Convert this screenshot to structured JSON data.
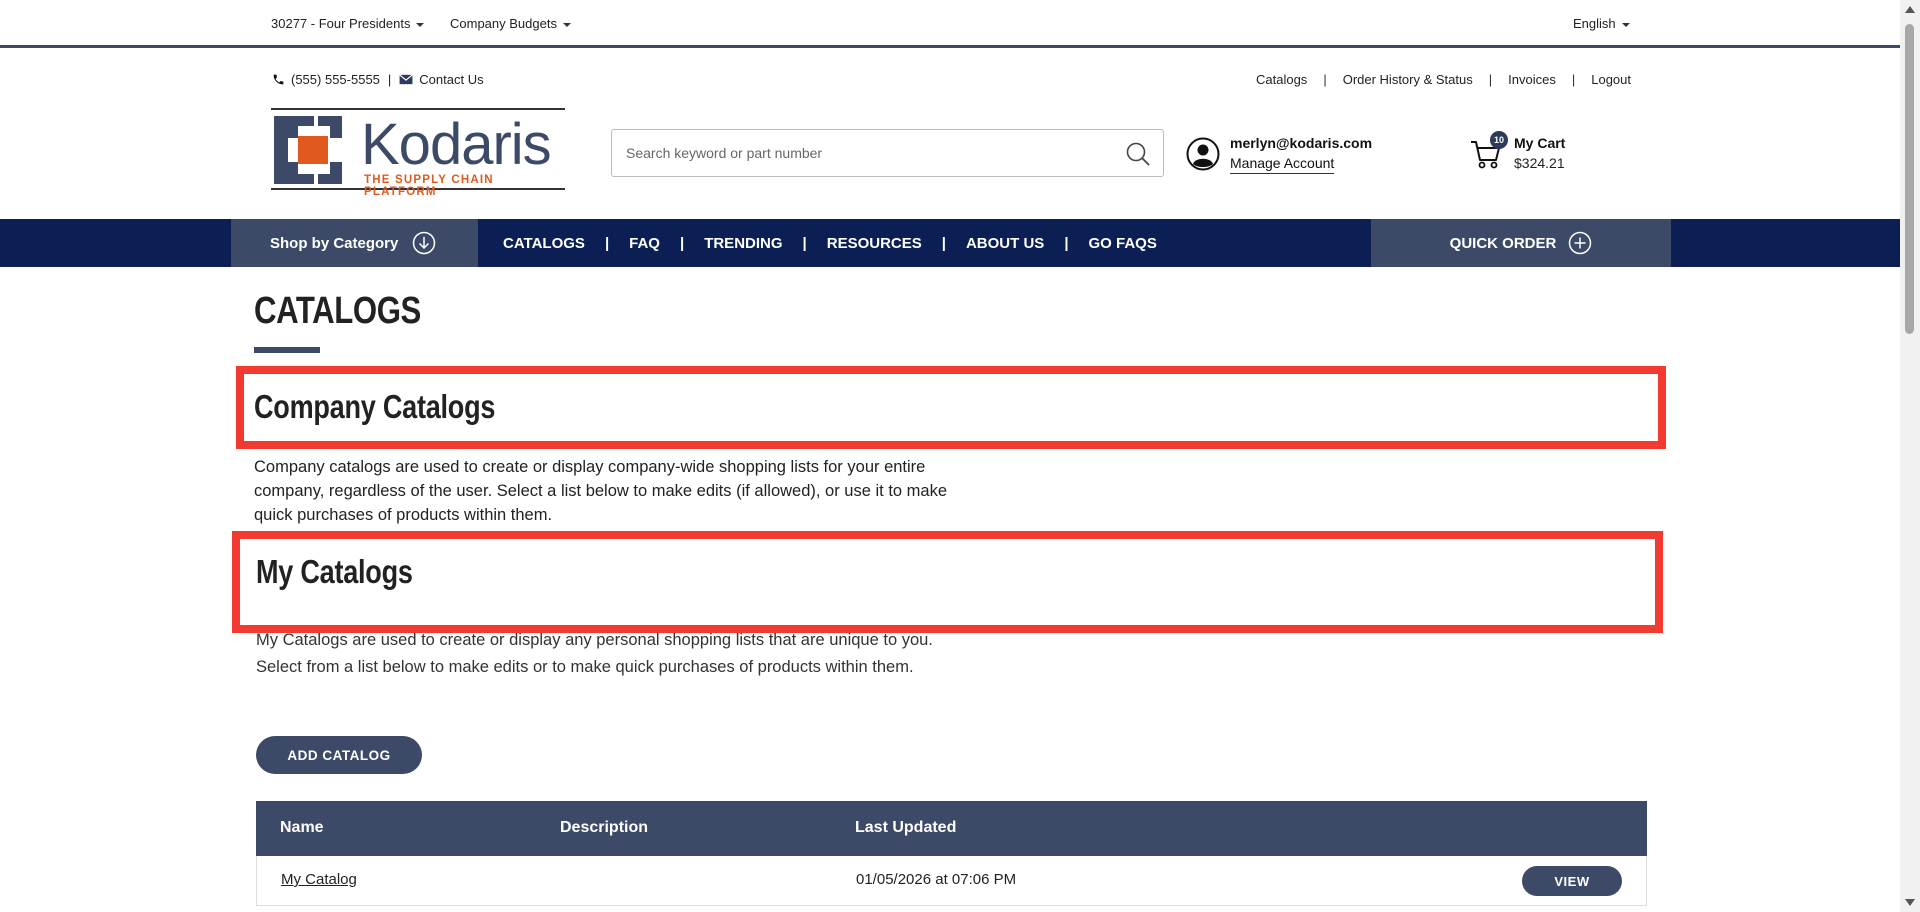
{
  "topbar": {
    "account_selector": "30277 - Four Presidents",
    "budgets": "Company Budgets",
    "language": "English"
  },
  "header": {
    "phone": "(555) 555-5555",
    "separator": "|",
    "contact": "Contact Us",
    "links": [
      "Catalogs",
      "Order History & Status",
      "Invoices",
      "Logout"
    ],
    "logo_word": "Kodaris",
    "logo_tagline": "THE SUPPLY CHAIN PLATFORM",
    "search_placeholder": "Search keyword or part number",
    "user_email": "merlyn@kodaris.com",
    "manage_account": "Manage Account",
    "cart_label": "My Cart",
    "cart_total": "$324.21",
    "cart_count": "10"
  },
  "nav": {
    "shop_by_category": "Shop by Category",
    "links": [
      "CATALOGS",
      "FAQ",
      "TRENDING",
      "RESOURCES",
      "ABOUT US",
      "GO FAQS"
    ],
    "separator": "|",
    "quick_order": "QUICK ORDER"
  },
  "main": {
    "title": "CATALOGS",
    "company_heading": "Company Catalogs",
    "company_text": "Company catalogs are used to create or display company-wide shopping lists for your entire company, regardless of the user. Select a list below to make edits (if allowed), or use it to make quick purchases of products within them.",
    "my_heading": "My Catalogs",
    "my_text": "My Catalogs are used to create or display any personal shopping lists that are unique to you. Select from a list below to make edits or to make quick purchases of products within them.",
    "add_button": "ADD CATALOG",
    "table": {
      "headers": [
        "Name",
        "Description",
        "Last Updated"
      ],
      "rows": [
        {
          "name": "My Catalog",
          "description": "",
          "updated": "01/05/2026 at 07:06 PM",
          "action": "VIEW"
        }
      ]
    }
  },
  "colors": {
    "navy": "#0b1f55",
    "slate": "#3d4a67",
    "orange": "#e05a20",
    "highlight": "#f23a30"
  }
}
